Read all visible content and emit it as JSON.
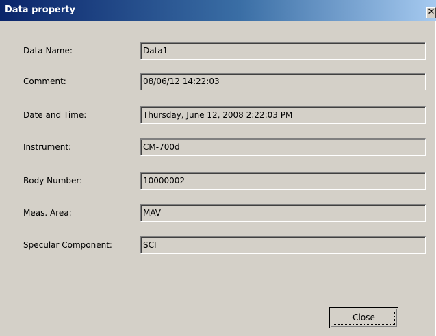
{
  "window": {
    "title": "Data property",
    "close_glyph": "✕"
  },
  "fields": [
    {
      "label": "Data Name:",
      "value": "Data1"
    },
    {
      "label": "Comment:",
      "value": "08/06/12 14:22:03"
    },
    {
      "label": "Date and Time:",
      "value": "Thursday, June 12, 2008 2:22:03 PM"
    },
    {
      "label": "Instrument:",
      "value": "CM-700d"
    },
    {
      "label": "Body Number:",
      "value": "10000002"
    },
    {
      "label": "Meas. Area:",
      "value": "MAV"
    },
    {
      "label": "Specular Component:",
      "value": "SCI"
    }
  ],
  "buttons": {
    "close_label": "Close"
  }
}
